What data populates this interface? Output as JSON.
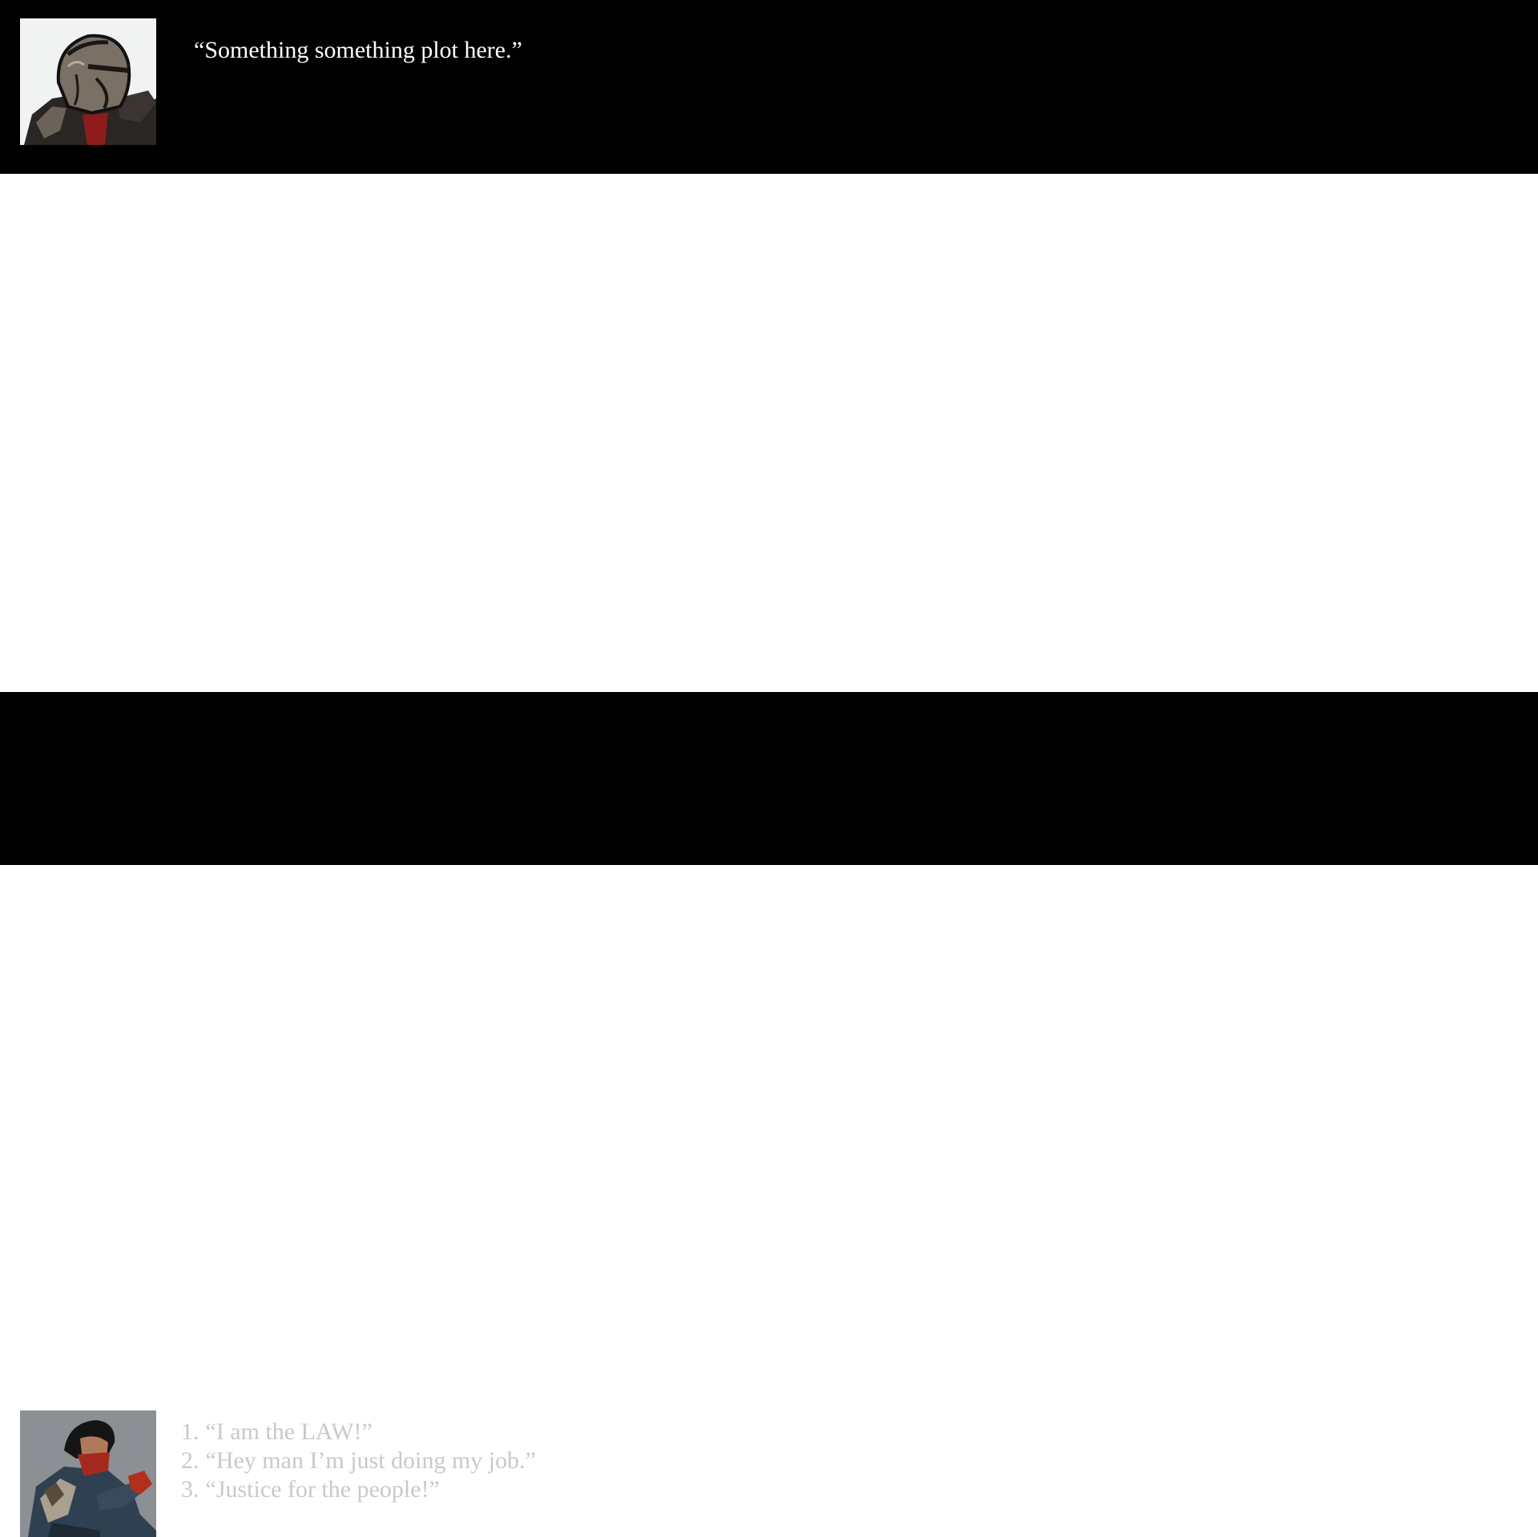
{
  "dialogue": {
    "npc": {
      "portrait_icon": "armored-knight-portrait",
      "line": "“Something something plot here.”"
    },
    "player": {
      "portrait_icon": "masked-highwayman-portrait",
      "choices": [
        {
          "number": "1.",
          "text": "“I am the LAW!”"
        },
        {
          "number": "2.",
          "text": "“Hey man I’m just doing my job.”"
        },
        {
          "number": "3.",
          "text": "“Justice for the people!”"
        }
      ]
    }
  },
  "colors": {
    "bar_background": "#000000",
    "scene_background": "#ffffff",
    "npc_text": "#ffffff",
    "choice_text": "#c9c9c9"
  }
}
